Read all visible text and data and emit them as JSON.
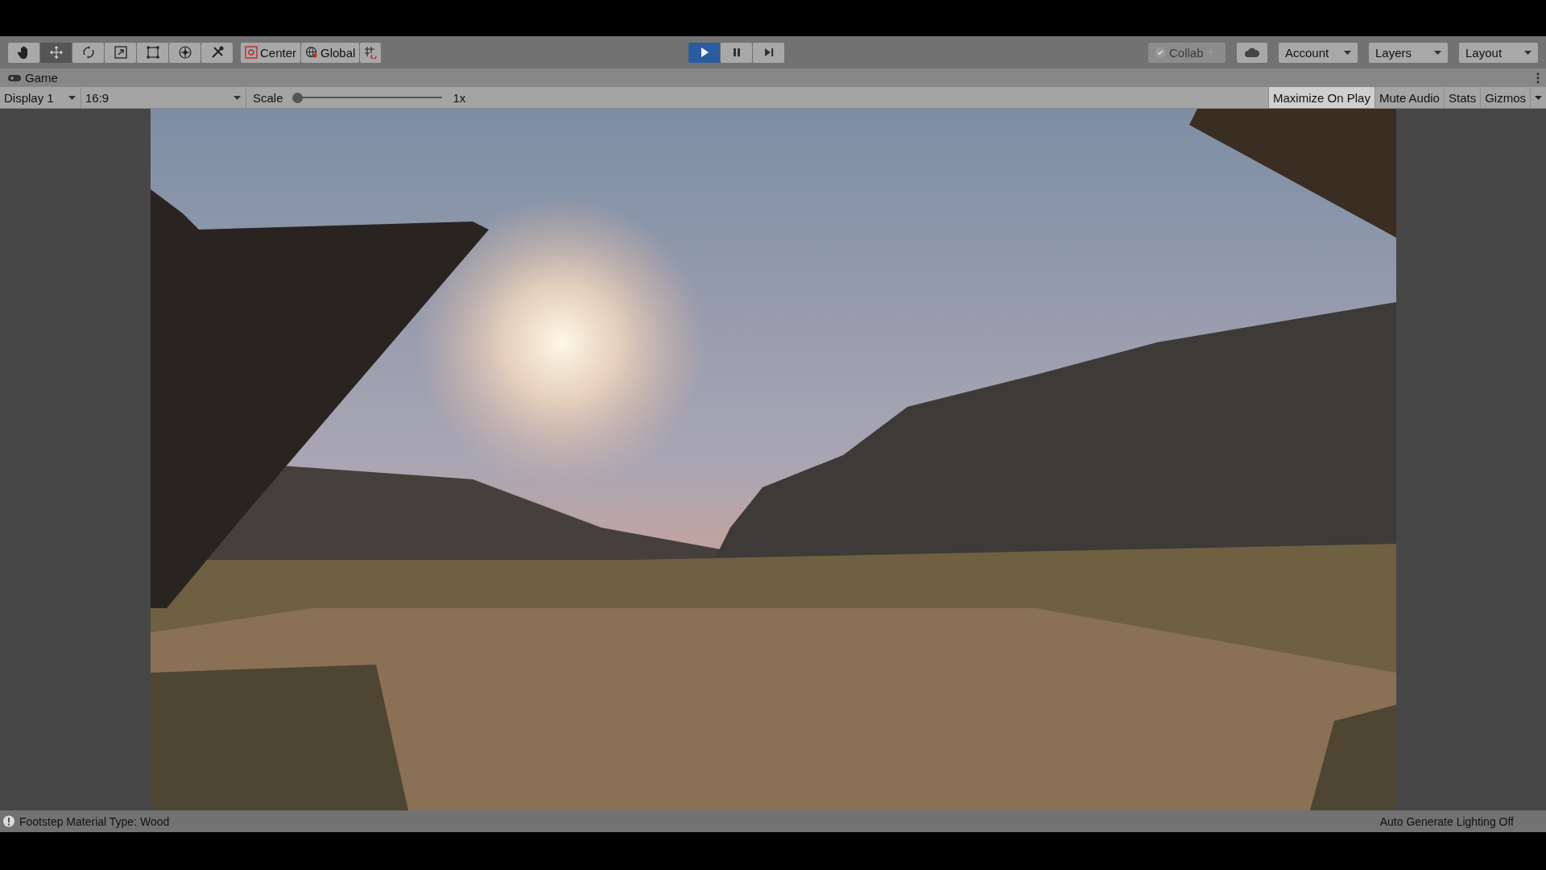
{
  "toolbar": {
    "tools": [
      {
        "kind": "hand",
        "selected": false
      },
      {
        "kind": "move",
        "selected": true
      },
      {
        "kind": "rotate",
        "selected": false
      },
      {
        "kind": "scale",
        "selected": false
      },
      {
        "kind": "rect",
        "selected": false
      },
      {
        "kind": "transform",
        "selected": false
      },
      {
        "kind": "custom",
        "selected": false
      }
    ],
    "pivot": [
      {
        "kind": "pivot",
        "label": "Center"
      },
      {
        "kind": "global",
        "label": "Global"
      },
      {
        "kind": "snap"
      }
    ],
    "play_controls": [
      {
        "kind": "play",
        "on": true
      },
      {
        "kind": "pause",
        "on": false
      },
      {
        "kind": "step",
        "on": false
      }
    ],
    "collab": {
      "label": "Collab",
      "disabled": true
    },
    "dropdowns": [
      {
        "kind": "cloud"
      },
      {
        "kind": "menu",
        "label": "Account"
      },
      {
        "kind": "menu",
        "label": "Layers"
      },
      {
        "kind": "menu",
        "label": "Layout"
      }
    ]
  },
  "tab": {
    "label": "Game"
  },
  "game_toolbar": {
    "display": "Display 1",
    "aspect": "16:9",
    "scale": {
      "label": "Scale",
      "level": 0,
      "reading": "1x"
    },
    "toggles": [
      {
        "label": "Maximize On Play",
        "selected": true
      },
      {
        "label": "Mute Audio",
        "selected": false
      },
      {
        "label": "Stats",
        "selected": false
      },
      {
        "label": "Gizmos",
        "selected": false
      }
    ]
  },
  "status_bar": {
    "message": "Footstep Material Type: Wood",
    "right": "Auto Generate Lighting Off"
  }
}
